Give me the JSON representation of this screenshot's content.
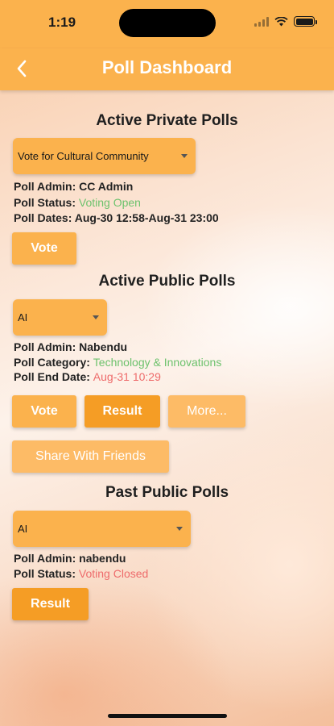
{
  "status_bar": {
    "time": "1:19"
  },
  "nav": {
    "title": "Poll Dashboard",
    "back_icon": "chevron-left-icon"
  },
  "private_polls": {
    "title": "Active Private Polls",
    "selected": "Vote for Cultural Community",
    "admin_label": "Poll Admin:",
    "admin_value": "CC Admin",
    "status_label": "Poll Status:",
    "status_value": "Voting Open",
    "dates_label": "Poll Dates:",
    "dates_value": "Aug-30 12:58-Aug-31 23:00",
    "vote_label": "Vote"
  },
  "public_polls": {
    "title": "Active Public Polls",
    "selected": "AI",
    "admin_label": "Poll Admin:",
    "admin_value": "Nabendu",
    "category_label": "Poll Category:",
    "category_value": "Technology & Innovations",
    "end_label": "Poll End Date:",
    "end_value": "Aug-31 10:29",
    "vote_label": "Vote",
    "result_label": "Result",
    "more_label": "More...",
    "share_label": "Share With Friends"
  },
  "past_polls": {
    "title": "Past Public Polls",
    "selected": "AI",
    "admin_label": "Poll Admin:",
    "admin_value": "nabendu",
    "status_label": "Poll Status:",
    "status_value": "Voting Closed",
    "result_label": "Result"
  },
  "colors": {
    "accent": "#fbb24d",
    "accent_dark": "#f59d25",
    "status_open": "#6dc26d",
    "status_closed": "#ee6b6b"
  }
}
